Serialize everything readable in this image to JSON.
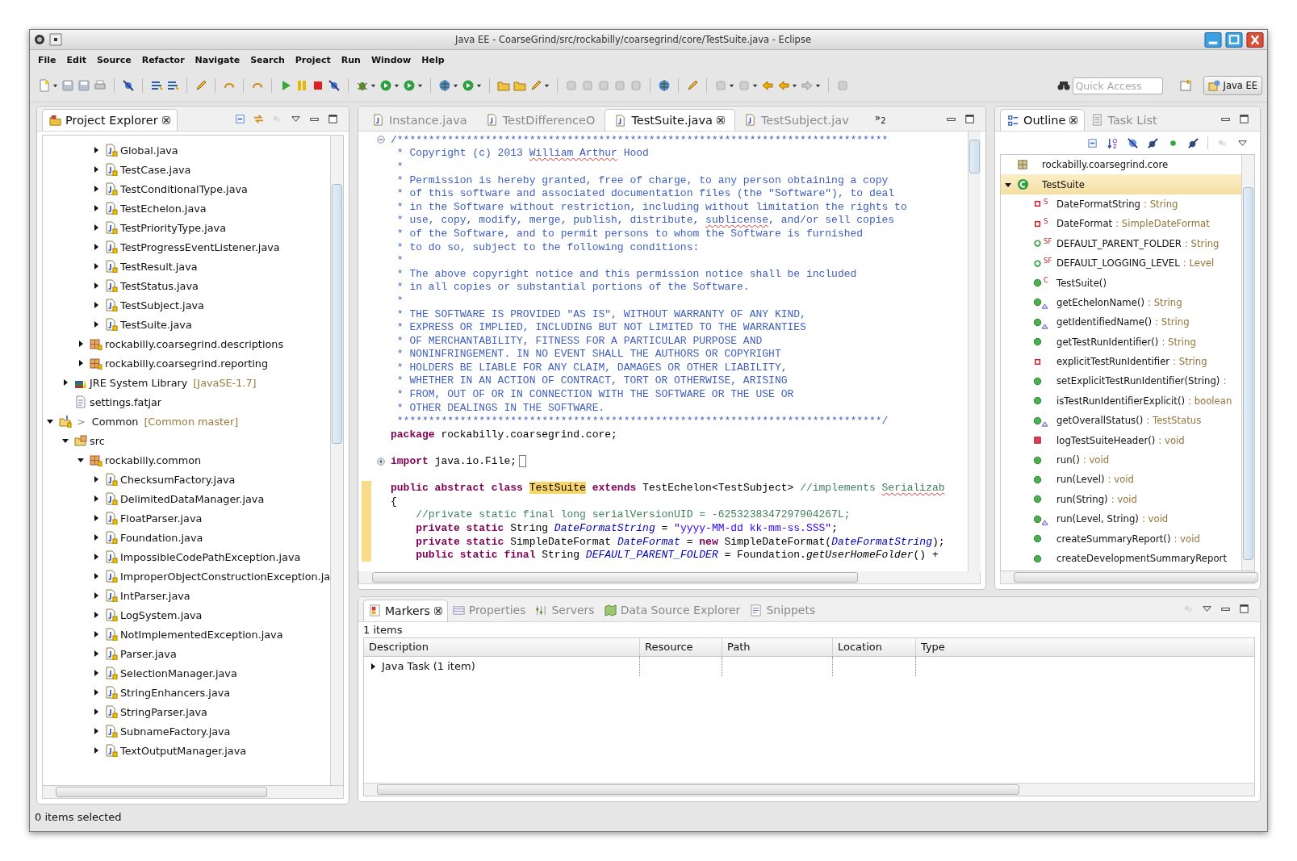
{
  "window": {
    "title": "Java EE - CoarseGrind/src/rockabilly/coarsegrind/core/TestSuite.java - Eclipse"
  },
  "menu": [
    "File",
    "Edit",
    "Source",
    "Refactor",
    "Navigate",
    "Search",
    "Project",
    "Run",
    "Window",
    "Help"
  ],
  "toolbar": {
    "quick_access": {
      "placeholder": "Quick Access"
    },
    "perspective": {
      "label": "Java EE",
      "selected": true
    }
  },
  "project_explorer": {
    "tabs": [
      {
        "label": "Project Explorer",
        "selected": true
      }
    ],
    "tree": [
      {
        "children": [
          {
            "children": [
              {
                "children": [
                  {
                    "label": "Global.java",
                    "kind": "java",
                    "expanded": false
                  },
                  {
                    "label": "TestCase.java",
                    "kind": "java",
                    "expanded": false
                  },
                  {
                    "label": "TestConditionalType.java",
                    "kind": "java",
                    "expanded": false
                  },
                  {
                    "label": "TestEchelon.java",
                    "kind": "java",
                    "expanded": false
                  },
                  {
                    "label": "TestPriorityType.java",
                    "kind": "java",
                    "expanded": false
                  },
                  {
                    "label": "TestProgressEventListener.java",
                    "kind": "java",
                    "expanded": false
                  },
                  {
                    "label": "TestResult.java",
                    "kind": "java",
                    "expanded": false
                  },
                  {
                    "label": "TestStatus.java",
                    "kind": "java",
                    "expanded": false
                  },
                  {
                    "label": "TestSubject.java",
                    "kind": "java",
                    "expanded": false
                  },
                  {
                    "label": "TestSuite.java",
                    "kind": "java",
                    "expanded": false
                  }
                ]
              },
              {
                "label": "rockabilly.coarsegrind.descriptions",
                "kind": "package",
                "expanded": false
              },
              {
                "label": "rockabilly.coarsegrind.reporting",
                "kind": "package",
                "expanded": false
              }
            ]
          },
          {
            "label": "JRE System Library",
            "decoration": "[JavaSE-1.7]",
            "kind": "library",
            "expanded": false
          },
          {
            "label": "settings.fatjar",
            "kind": "file"
          }
        ]
      },
      {
        "label": "Common",
        "prefix": ">",
        "decoration": "[Common master]",
        "kind": "project",
        "expanded": true,
        "children": [
          {
            "label": "src",
            "kind": "source-folder",
            "expanded": true,
            "children": [
              {
                "label": "rockabilly.common",
                "kind": "package",
                "expanded": true,
                "children": [
                  {
                    "label": "ChecksumFactory.java",
                    "kind": "java",
                    "expanded": false
                  },
                  {
                    "label": "DelimitedDataManager.java",
                    "kind": "java",
                    "expanded": false
                  },
                  {
                    "label": "FloatParser.java",
                    "kind": "java",
                    "expanded": false
                  },
                  {
                    "label": "Foundation.java",
                    "kind": "java",
                    "expanded": false
                  },
                  {
                    "label": "ImpossibleCodePathException.java",
                    "kind": "java",
                    "expanded": false
                  },
                  {
                    "label": "ImproperObjectConstructionException.ja",
                    "kind": "java",
                    "expanded": false
                  },
                  {
                    "label": "IntParser.java",
                    "kind": "java",
                    "expanded": false
                  },
                  {
                    "label": "LogSystem.java",
                    "kind": "java",
                    "expanded": false
                  },
                  {
                    "label": "NotImplementedException.java",
                    "kind": "java",
                    "expanded": false
                  },
                  {
                    "label": "Parser.java",
                    "kind": "java",
                    "expanded": false
                  },
                  {
                    "label": "SelectionManager.java",
                    "kind": "java",
                    "expanded": false
                  },
                  {
                    "label": "StringEnhancers.java",
                    "kind": "java",
                    "expanded": false
                  },
                  {
                    "label": "StringParser.java",
                    "kind": "java",
                    "expanded": false
                  },
                  {
                    "label": "SubnameFactory.java",
                    "kind": "java",
                    "expanded": false
                  },
                  {
                    "label": "TextOutputManager.java",
                    "kind": "java",
                    "expanded": false
                  }
                ]
              }
            ]
          }
        ]
      }
    ]
  },
  "editor": {
    "tabs": [
      {
        "label": "Instance.java",
        "selected": false
      },
      {
        "label": "TestDifferenceO",
        "selected": false
      },
      {
        "label": "TestSuite.java",
        "selected": true
      },
      {
        "label": "TestSubject.jav",
        "selected": false
      }
    ],
    "overflow": "»$_{2}$",
    "lines": [
      {
        "folded": false,
        "marked": false,
        "segments": [
          {
            "t": "/******************************************************************************",
            "kind": "doc"
          }
        ]
      },
      {
        "marked": false,
        "segments": [
          {
            "t": " * Copyright (c) 2013 ",
            "kind": "doc"
          },
          {
            "t": "William Arthur",
            "kind": "doc-typo"
          },
          {
            "t": " Hood",
            "kind": "doc"
          }
        ]
      },
      {
        "marked": false,
        "segments": [
          {
            "t": " *",
            "kind": "doc"
          }
        ]
      },
      {
        "marked": false,
        "segments": [
          {
            "t": " * Permission is hereby granted, free of charge, to any person obtaining a copy",
            "kind": "doc"
          }
        ]
      },
      {
        "marked": false,
        "segments": [
          {
            "t": " * of this software and associated documentation files (the \"Software\"), to deal",
            "kind": "doc"
          }
        ]
      },
      {
        "marked": false,
        "segments": [
          {
            "t": " * in the Software without restriction, including without limitation the rights to",
            "kind": "doc"
          }
        ]
      },
      {
        "marked": false,
        "segments": [
          {
            "t": " * use, copy, modify, merge, publish, distribute, ",
            "kind": "doc"
          },
          {
            "t": "sublicense",
            "kind": "doc-typo"
          },
          {
            "t": ", and/or sell copies",
            "kind": "doc"
          }
        ]
      },
      {
        "marked": false,
        "segments": [
          {
            "t": " * of the Software, and to permit persons to whom the Software is furnished",
            "kind": "doc"
          }
        ]
      },
      {
        "marked": false,
        "segments": [
          {
            "t": " * to do so, subject to the following conditions:",
            "kind": "doc"
          }
        ]
      },
      {
        "marked": false,
        "segments": [
          {
            "t": " *",
            "kind": "doc"
          }
        ]
      },
      {
        "marked": false,
        "segments": [
          {
            "t": " * The above copyright notice and this permission notice shall be included",
            "kind": "doc"
          }
        ]
      },
      {
        "marked": false,
        "segments": [
          {
            "t": " * in all copies or substantial portions of the Software.",
            "kind": "doc"
          }
        ]
      },
      {
        "marked": false,
        "segments": [
          {
            "t": " *",
            "kind": "doc"
          }
        ]
      },
      {
        "marked": false,
        "segments": [
          {
            "t": " * THE SOFTWARE IS PROVIDED \"AS IS\", WITHOUT WARRANTY OF ANY KIND,",
            "kind": "doc"
          }
        ]
      },
      {
        "marked": false,
        "segments": [
          {
            "t": " * EXPRESS OR IMPLIED, INCLUDING BUT NOT LIMITED TO THE WARRANTIES",
            "kind": "doc"
          }
        ]
      },
      {
        "marked": false,
        "segments": [
          {
            "t": " * OF MERCHANTABILITY, FITNESS FOR A PARTICULAR PURPOSE AND",
            "kind": "doc"
          }
        ]
      },
      {
        "marked": false,
        "segments": [
          {
            "t": " * NONINFRINGEMENT. IN NO EVENT SHALL THE AUTHORS OR COPYRIGHT",
            "kind": "doc"
          }
        ]
      },
      {
        "marked": false,
        "segments": [
          {
            "t": " * HOLDERS BE LIABLE FOR ANY CLAIM, DAMAGES OR OTHER LIABILITY,",
            "kind": "doc"
          }
        ]
      },
      {
        "marked": false,
        "segments": [
          {
            "t": " * WHETHER IN AN ACTION OF CONTRACT, TORT OR OTHERWISE, ARISING",
            "kind": "doc"
          }
        ]
      },
      {
        "marked": false,
        "segments": [
          {
            "t": " * FROM, OUT OF OR IN CONNECTION WITH THE SOFTWARE OR THE USE OR",
            "kind": "doc"
          }
        ]
      },
      {
        "marked": false,
        "segments": [
          {
            "t": " * OTHER DEALINGS IN THE SOFTWARE.",
            "kind": "doc"
          }
        ]
      },
      {
        "marked": false,
        "segments": [
          {
            "t": " *****************************************************************************/",
            "kind": "doc"
          }
        ]
      },
      {
        "marked": false,
        "segments": [
          {
            "t": "package",
            "kind": "keyword"
          },
          {
            "t": " rockabilly.coarsegrind.core;",
            "kind": "plain"
          }
        ]
      },
      {
        "marked": false
      },
      {
        "folded": true,
        "marked": false,
        "segments": [
          {
            "t": "import",
            "kind": "keyword"
          },
          {
            "t": " java.io.File;",
            "kind": "plain"
          }
        ]
      },
      {
        "marked": false
      },
      {
        "marked": true,
        "segments": [
          {
            "t": "public abstract class ",
            "kind": "keyword"
          },
          {
            "t": "TestSuite",
            "kind": "occurrence"
          },
          {
            "t": " extends",
            "kind": "keyword"
          },
          {
            "t": " TestEchelon<TestSubject> ",
            "kind": "plain"
          },
          {
            "t": "//implements ",
            "kind": "comment"
          },
          {
            "t": "Serializab",
            "kind": "comment-typo"
          }
        ]
      },
      {
        "marked": true,
        "segments": [
          {
            "t": "{",
            "kind": "plain"
          }
        ]
      },
      {
        "marked": true,
        "segments": [
          {
            "t": "    //private static final long serialVersionUID = -6253238347297904267L;",
            "kind": "comment"
          }
        ]
      },
      {
        "marked": true,
        "segments": [
          {
            "t": "    private static",
            "kind": "keyword"
          },
          {
            "t": " String ",
            "kind": "plain"
          },
          {
            "t": "DateFormatString",
            "kind": "field"
          },
          {
            "t": " = ",
            "kind": "plain"
          },
          {
            "t": "\"yyyy-MM-dd kk-mm-ss.SSS\"",
            "kind": "string"
          },
          {
            "t": ";",
            "kind": "plain"
          }
        ]
      },
      {
        "marked": true,
        "segments": [
          {
            "t": "    private static",
            "kind": "keyword"
          },
          {
            "t": " SimpleDateFormat ",
            "kind": "plain"
          },
          {
            "t": "DateFormat",
            "kind": "field"
          },
          {
            "t": " = ",
            "kind": "plain"
          },
          {
            "t": "new",
            "kind": "keyword"
          },
          {
            "t": " SimpleDateFormat(",
            "kind": "plain"
          },
          {
            "t": "DateFormatString",
            "kind": "field"
          },
          {
            "t": ");",
            "kind": "plain"
          }
        ]
      },
      {
        "marked": true,
        "segments": [
          {
            "t": "    public static final",
            "kind": "keyword"
          },
          {
            "t": " String ",
            "kind": "plain"
          },
          {
            "t": "DEFAULT_PARENT_FOLDER",
            "kind": "field"
          },
          {
            "t": " = Foundation.",
            "kind": "plain"
          },
          {
            "t": "getUserHomeFolder",
            "kind": "static-call"
          },
          {
            "t": "() +",
            "kind": "plain"
          }
        ]
      }
    ]
  },
  "outline": {
    "tabs": [
      {
        "label": "Outline",
        "selected": true
      },
      {
        "label": "Task List",
        "selected": false
      }
    ],
    "tree": [
      {
        "label": "rockabilly.coarsegrind.core",
        "kind": "package",
        "selected": false
      },
      {
        "label": "TestSuite",
        "kind": "class",
        "expanded": true,
        "selected": true,
        "children": [
          {
            "label": "DateFormatString",
            "type": ": String",
            "kind": "private-field",
            "modifier": "S",
            "override": false,
            "selected": false
          },
          {
            "label": "DateFormat",
            "type": ": SimpleDateFormat",
            "kind": "private-field",
            "modifier": "S",
            "override": false,
            "selected": false
          },
          {
            "label": "DEFAULT_PARENT_FOLDER",
            "type": ": String",
            "kind": "public-field",
            "modifier": "SF",
            "override": false,
            "selected": false
          },
          {
            "label": "DEFAULT_LOGGING_LEVEL",
            "type": ": Level",
            "kind": "public-field",
            "modifier": "SF",
            "override": false,
            "selected": false
          },
          {
            "label": "TestSuite()",
            "kind": "public-method",
            "modifier": "C",
            "override": false,
            "selected": false
          },
          {
            "label": "getEchelonName()",
            "type": ": String",
            "kind": "public-method",
            "override": true,
            "selected": false
          },
          {
            "label": "getIdentifiedName()",
            "type": ": String",
            "kind": "public-method",
            "override": true,
            "selected": false
          },
          {
            "label": "getTestRunIdentifier()",
            "type": ": String",
            "kind": "public-method",
            "override": false,
            "selected": false
          },
          {
            "label": "explicitTestRunIdentifier",
            "type": ": String",
            "kind": "private-field",
            "override": false,
            "selected": false
          },
          {
            "label": "setExplicitTestRunIdentifier(String)",
            "type": ":",
            "kind": "public-method",
            "override": false,
            "selected": false
          },
          {
            "label": "isTestRunIdentifierExplicit()",
            "type": ": boolean",
            "kind": "public-method",
            "override": false,
            "selected": false
          },
          {
            "label": "getOverallStatus()",
            "type": ": TestStatus",
            "kind": "public-method",
            "override": true,
            "selected": false
          },
          {
            "label": "logTestSuiteHeader()",
            "type": ": void",
            "kind": "private-method",
            "override": false,
            "selected": false
          },
          {
            "label": "run()",
            "type": ": void",
            "kind": "public-method",
            "override": false,
            "selected": false
          },
          {
            "label": "run(Level)",
            "type": ": void",
            "kind": "public-method",
            "override": false,
            "selected": false
          },
          {
            "label": "run(String)",
            "type": ": void",
            "kind": "public-method",
            "override": false,
            "selected": false
          },
          {
            "label": "run(Level, String)",
            "type": ": void",
            "kind": "public-method",
            "override": true,
            "selected": false
          },
          {
            "label": "createSummaryReport()",
            "type": ": void",
            "kind": "public-method",
            "override": false,
            "selected": false
          },
          {
            "label": "createDevelopmentSummaryReport",
            "kind": "public-method",
            "override": false,
            "selected": false
          }
        ]
      }
    ]
  },
  "markers": {
    "tabs": [
      {
        "label": "Markers",
        "kind": "markers",
        "selected": true
      },
      {
        "label": "Properties",
        "kind": "properties",
        "selected": false
      },
      {
        "label": "Servers",
        "kind": "servers",
        "selected": false
      },
      {
        "label": "Data Source Explorer",
        "kind": "datasource",
        "selected": false
      },
      {
        "label": "Snippets",
        "kind": "snippets",
        "selected": false
      }
    ],
    "count": "1 items",
    "columns": [
      "Description",
      "Resource",
      "Path",
      "Location",
      "Type"
    ],
    "rows": [
      {
        "cells": [
          "Java Task (1 item)"
        ],
        "expanded": false
      }
    ]
  },
  "status_bar": {
    "text": "0 items selected"
  }
}
